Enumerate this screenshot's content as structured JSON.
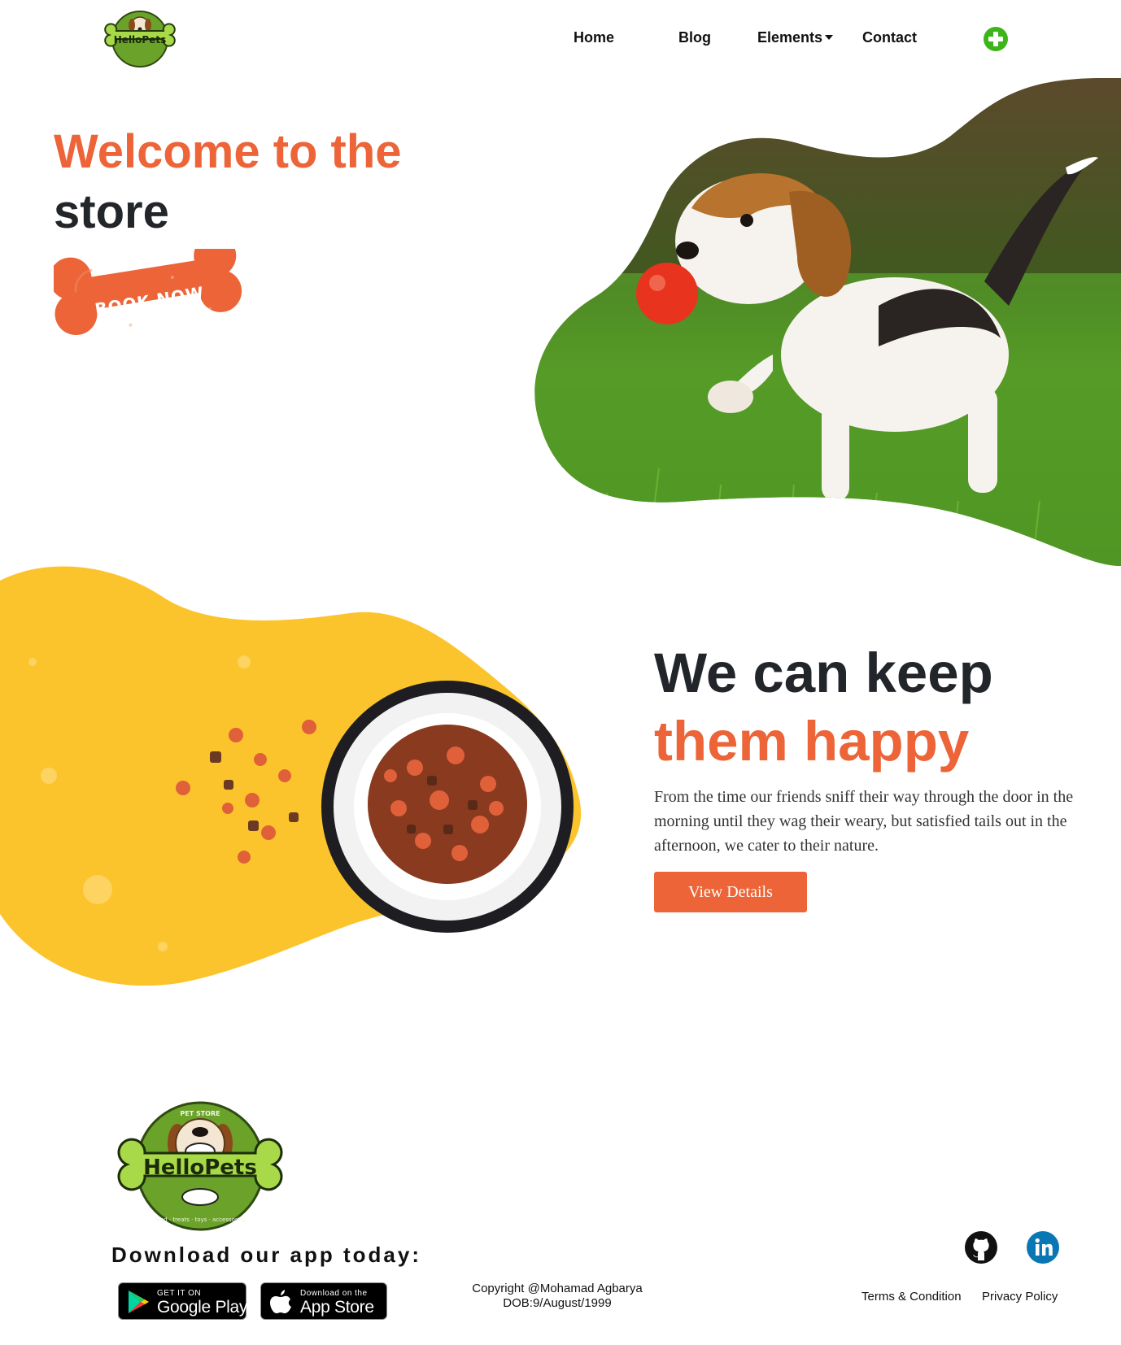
{
  "nav": {
    "logo_text": "HelloPets",
    "links": [
      "Home",
      "Blog",
      "Elements",
      "Contact"
    ]
  },
  "hero": {
    "title_line1": "Welcome to the",
    "title_line2": "store",
    "cta_label": "BOOK NOW"
  },
  "feature": {
    "title_line1": "We can keep",
    "title_line2": "them happy",
    "body": "From the time our friends sniff their way through the door in the morning until they wag their weary, but satisfied tails out in the afternoon, we cater to their nature.",
    "button_label": "View Details"
  },
  "footer": {
    "logo_text": "HelloPets",
    "logo_top_text": "PET STORE",
    "logo_bottom_text": "food · treats · toys · accessories",
    "download_title": "Download our app today:",
    "google_small": "GET IT ON",
    "google_big": "Google Play",
    "apple_small": "Download on the",
    "apple_big": "App Store",
    "copyright_line1": "Copyright @Mohamad Agbarya",
    "copyright_line2": "DOB:9/August/1999",
    "terms": "Terms & Condition",
    "privacy": "Privacy Policy"
  },
  "colors": {
    "accent_orange": "#ec6437",
    "dark_text": "#222529",
    "yellow_blob": "#fcc42c",
    "logo_green": "#6aa22a",
    "plus_green": "#3db51a",
    "linkedin_blue": "#0a77b5"
  },
  "icons": [
    "plus-circle-icon",
    "github-icon",
    "linkedin-icon",
    "google-play-icon",
    "apple-icon",
    "caret-down-icon"
  ]
}
